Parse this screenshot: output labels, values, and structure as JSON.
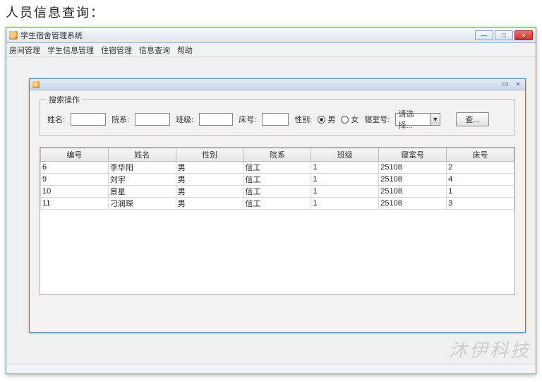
{
  "heading": "人员信息查询：",
  "window": {
    "title": "学生宿舍管理系统",
    "min": "—",
    "max": "□",
    "close": "×"
  },
  "menubar": [
    "房间管理",
    "学生信息管理",
    "住宿管理",
    "信息查询",
    "帮助"
  ],
  "internal_frame": {
    "iconify": "▭",
    "close": "×"
  },
  "group_legend": "搜索操作",
  "filters": {
    "name_label": "姓名:",
    "dept_label": "院系:",
    "class_label": "班级:",
    "bed_label": "床号:",
    "gender_label": "性别:",
    "gender_male": "男",
    "gender_female": "女",
    "dorm_label": "寝室号:",
    "dorm_placeholder": "请选择...",
    "search_btn": "查..."
  },
  "columns": [
    "编号",
    "姓名",
    "性别",
    "院系",
    "班级",
    "寝室号",
    "床号"
  ],
  "rows": [
    {
      "id": "6",
      "name": "李华阳",
      "gender": "男",
      "dept": "信工",
      "class": "1",
      "dorm": "25108",
      "bed": "2"
    },
    {
      "id": "9",
      "name": "刘宇",
      "gender": "男",
      "dept": "信工",
      "class": "1",
      "dorm": "25108",
      "bed": "4"
    },
    {
      "id": "10",
      "name": "景星",
      "gender": "男",
      "dept": "信工",
      "class": "1",
      "dorm": "25108",
      "bed": "1"
    },
    {
      "id": "11",
      "name": "刁润琛",
      "gender": "男",
      "dept": "信工",
      "class": "1",
      "dorm": "25108",
      "bed": "3"
    }
  ],
  "watermark": "沐伊科技"
}
